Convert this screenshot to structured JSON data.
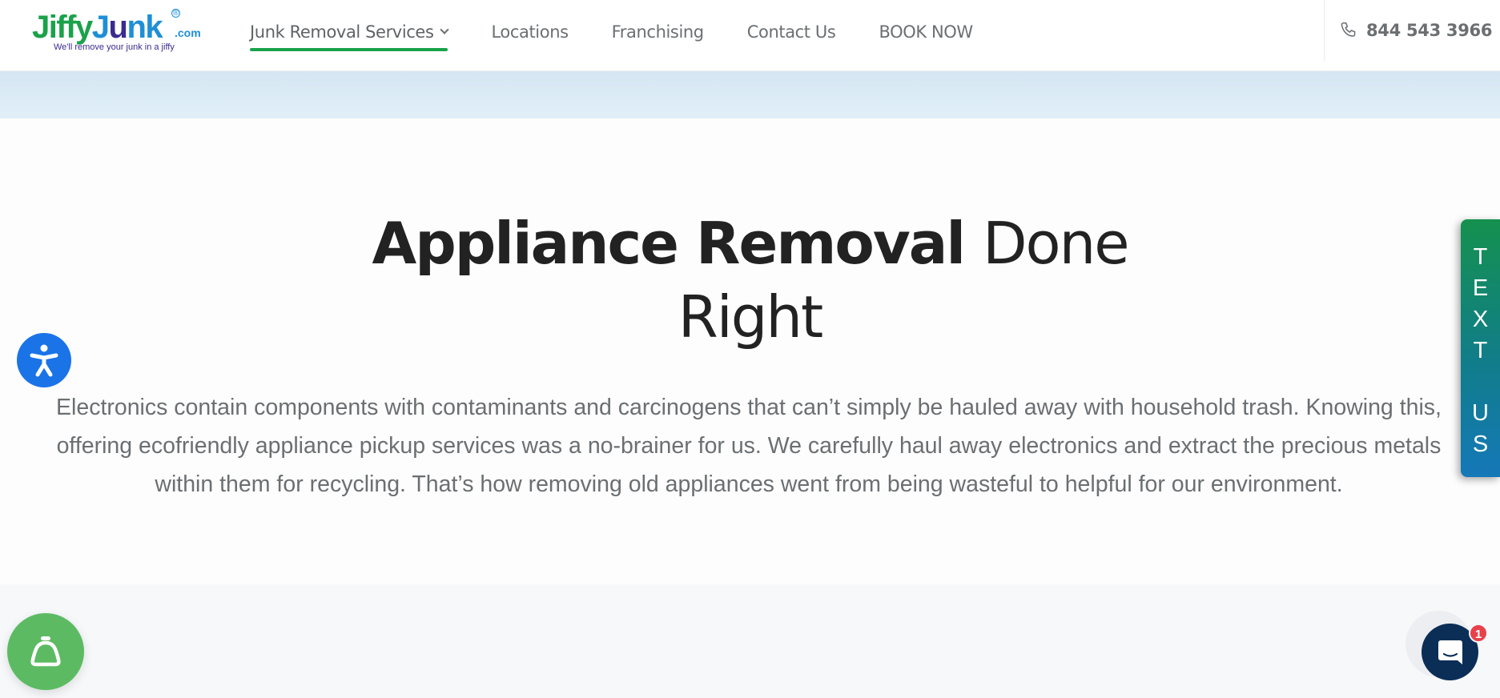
{
  "header": {
    "logo": {
      "part1": "Jiffy",
      "part2": "J",
      "part3": "u",
      "part4": "nk",
      "suffix": ".com",
      "registered": "®",
      "tagline": "We'll remove your junk in a jiffy"
    },
    "nav": [
      {
        "label": "Junk Removal Services",
        "active": true,
        "has_dropdown": true
      },
      {
        "label": "Locations"
      },
      {
        "label": "Franchising"
      },
      {
        "label": "Contact Us"
      },
      {
        "label": "BOOK NOW"
      }
    ],
    "phone": "844 543 3966"
  },
  "hero": {
    "title_bold": "Appliance Removal",
    "title_light_1": "Done",
    "title_light_2": "Right",
    "description": "Electronics contain components with contaminants and carcinogens that can’t simply be hauled away with household trash. Knowing this, offering ecofriendly appliance pickup services was a no-brainer for us. We carefully haul away electronics and extract the precious metals within them for recycling. That’s how removing old appliances went from being wasteful to helpful for our environment."
  },
  "widgets": {
    "text_us_letters": [
      "T",
      "E",
      "X",
      "T",
      "",
      "U",
      "S"
    ],
    "chat_badge_count": "1",
    "accessibility_icon": "accessibility-icon",
    "bell_icon": "service-bell-icon",
    "chat_icon": "chat-bubble-icon"
  },
  "colors": {
    "brand_green": "#17a34a",
    "brand_blue": "#1e8fd6",
    "accessibility_blue": "#1b73e8",
    "bell_green": "#5cbb62",
    "chat_navy": "#0b2e57",
    "badge_red": "#e8414a"
  }
}
